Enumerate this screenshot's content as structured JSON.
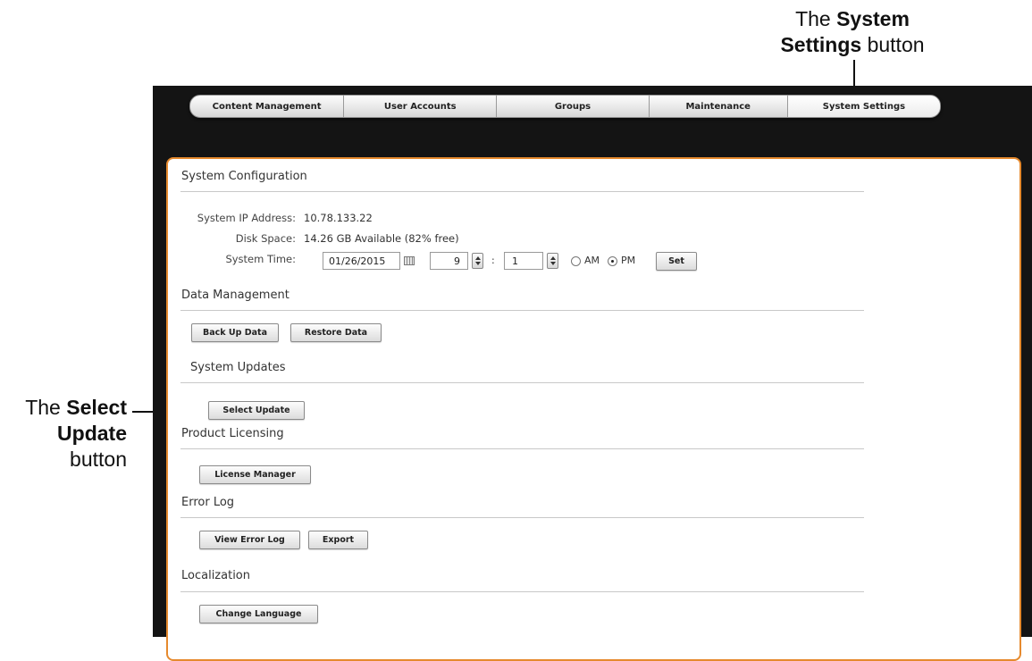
{
  "callouts": {
    "system_settings": {
      "prefix": "The ",
      "bold": "System Settings",
      "suffix": " button"
    },
    "select_update": {
      "prefix": "The ",
      "bold": "Select Update",
      "suffix": " button"
    }
  },
  "tabs": [
    {
      "label": "Content Management",
      "active": false
    },
    {
      "label": "User Accounts",
      "active": false
    },
    {
      "label": "Groups",
      "active": false
    },
    {
      "label": "Maintenance",
      "active": false
    },
    {
      "label": "System Settings",
      "active": true
    }
  ],
  "system_configuration": {
    "title": "System Configuration",
    "ip_label": "System IP Address:",
    "ip_value": "10.78.133.22",
    "disk_label": "Disk Space:",
    "disk_value": "14.26 GB Available (82% free)",
    "time_label": "System Time:",
    "date_value": "01/26/2015",
    "hour_value": "9",
    "minute_value": "1",
    "time_separator": ":",
    "am_label": "AM",
    "pm_label": "PM",
    "selected_period": "PM",
    "set_button": "Set"
  },
  "data_management": {
    "title": "Data Management",
    "backup_button": "Back Up Data",
    "restore_button": "Restore Data"
  },
  "system_updates": {
    "title": "System Updates",
    "select_update_button": "Select Update"
  },
  "product_licensing": {
    "title": "Product Licensing",
    "license_manager_button": "License Manager"
  },
  "error_log": {
    "title": "Error Log",
    "view_button": "View Error Log",
    "export_button": "Export"
  },
  "localization": {
    "title": "Localization",
    "change_language_button": "Change Language"
  },
  "colors": {
    "panel_border": "#e68a2e",
    "app_background": "#141414"
  },
  "icons": {
    "calendar": "calendar-icon",
    "spinner": "spinner-arrows-icon"
  }
}
